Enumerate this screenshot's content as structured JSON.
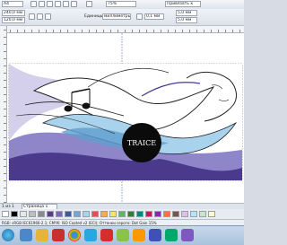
{
  "toolbar": {
    "row1_left": "A4",
    "zoom": "75%",
    "snap": "Привязать к",
    "units_label": "Единицы:",
    "units_value": "миллиметры",
    "nudge": "0,1 мм",
    "width": "240,0 мм",
    "height": "120,0 мм",
    "dup_x": "5,0 мм",
    "dup_y": "5,0 мм"
  },
  "page_tab": "Страница 1",
  "page_counter": "1 из 1",
  "status_text": "RGB: sRGB IEC61966-2.1; CMYK: ISO Coated v2 (ECI); Оттенки серого: Dot Gain 15%",
  "artwork": {
    "logo_text": "TRAICE"
  },
  "palette": {
    "colors": [
      "#ffffff",
      "#000000",
      "#e8e8e8",
      "#bdbdbd",
      "#8a8a8a",
      "#5a3b8c",
      "#7b68b8",
      "#3b5aa0",
      "#6fa8d8",
      "#a7d3ef",
      "#d9534f",
      "#f0ad4e",
      "#f7e463",
      "#5cb85c",
      "#2e7d32",
      "#00897b",
      "#c2185b",
      "#8e24aa",
      "#ff7043",
      "#795548",
      "#e1bee7",
      "#b3e5fc",
      "#c8e6c9",
      "#fff9c4"
    ]
  },
  "colors": {
    "purple_dark": "#4b3a8c",
    "purple_mid": "#8f86c9",
    "lilac": "#c9c3e6",
    "blue_light": "#a9d2ec",
    "blue_mid": "#5f9fd0"
  }
}
